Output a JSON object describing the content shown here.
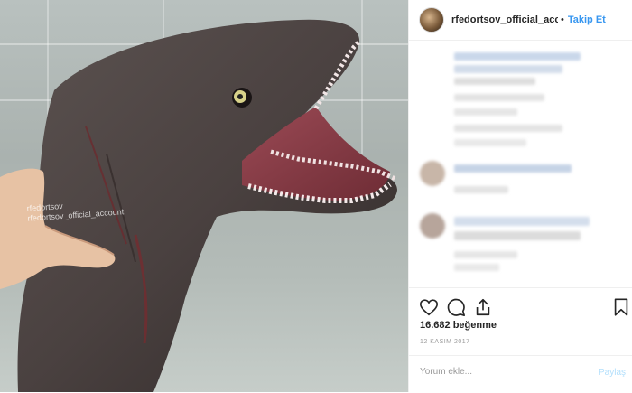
{
  "photo": {
    "watermark_line1": "rfedortsov",
    "watermark_line2": "rfedortsov_official_account"
  },
  "header": {
    "username": "rfedortsov_official_accou",
    "separator": "•",
    "follow_label": "Takip Et"
  },
  "post": {
    "likes": "16.682 beğenme",
    "date": "12 KASIM 2017"
  },
  "comment": {
    "placeholder": "Yorum ekle...",
    "post_label": "Paylaş"
  },
  "colors": {
    "follow_accent": "#3897f0",
    "post_button_disabled": "#b2dffc"
  }
}
